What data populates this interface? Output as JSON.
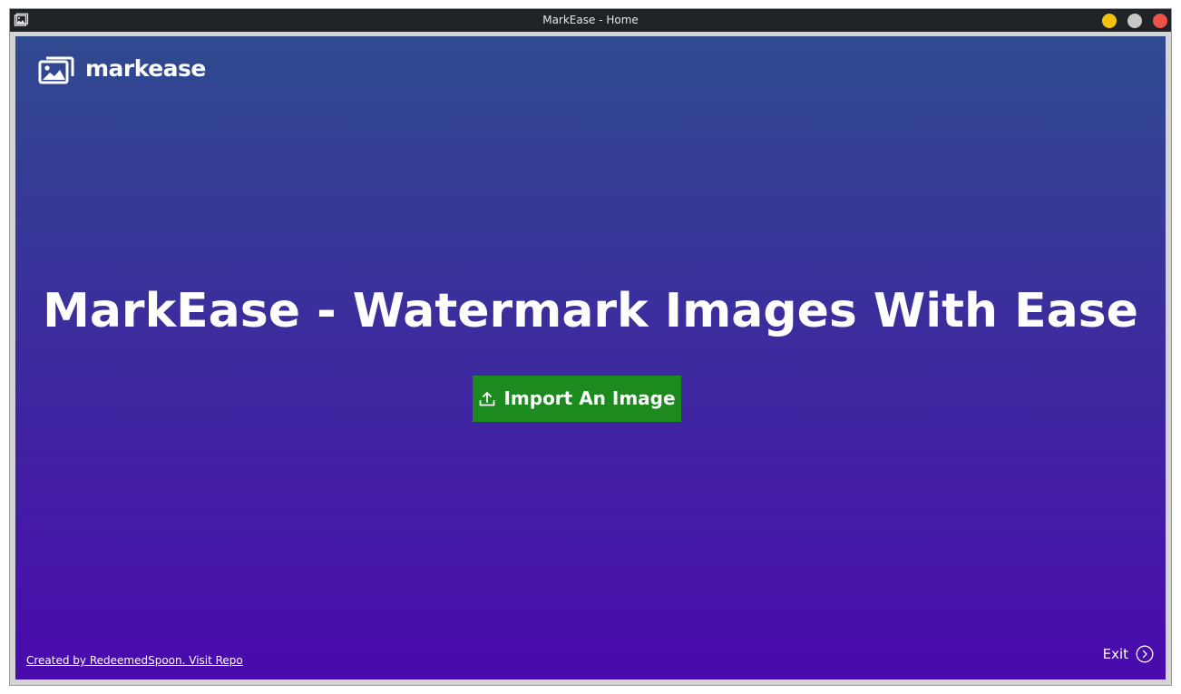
{
  "window": {
    "title": "MarkEase - Home",
    "controls": {
      "minimize_color": "#f4c20d",
      "maximize_color": "#c7c7c7",
      "close_color": "#f0504a"
    }
  },
  "theme": {
    "gradient_top": "#2f4a8f",
    "gradient_bottom": "#4a0aad",
    "button_green": "#1c8a1f",
    "text_color": "#ffffff"
  },
  "brand": {
    "name": "markease",
    "icon": "images-icon"
  },
  "hero": {
    "title": "MarkEase - Watermark Images With Ease"
  },
  "import_button": {
    "label": "Import An Image",
    "icon": "upload-icon"
  },
  "footer": {
    "credit_link": "Created by RedeemedSpoon. Visit Repo"
  },
  "exit": {
    "label": "Exit",
    "icon": "chevron-right-circle-icon"
  }
}
